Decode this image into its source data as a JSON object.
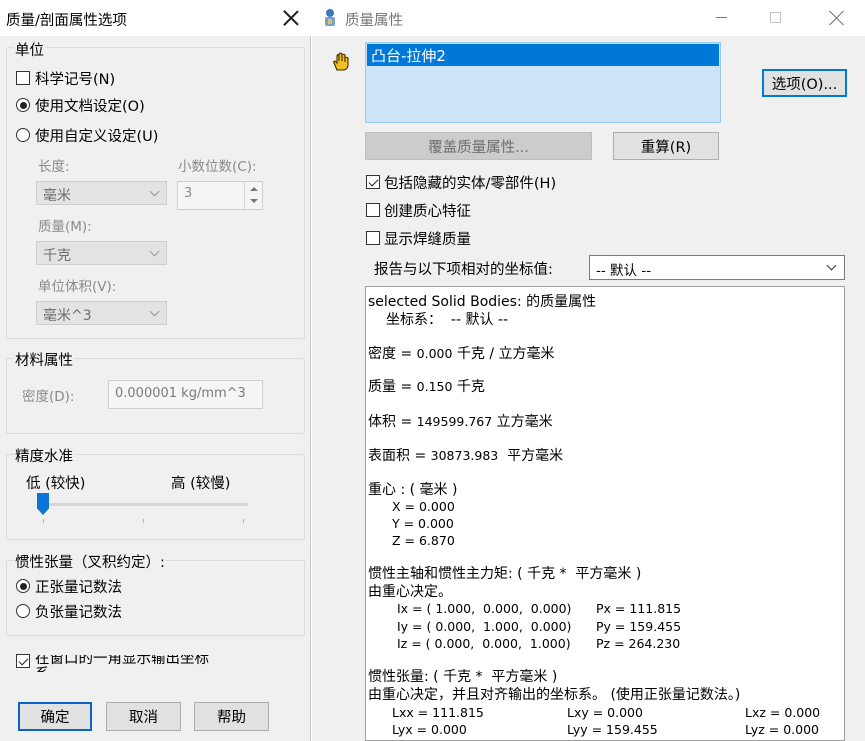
{
  "left": {
    "title": "质量/剖面属性选项",
    "units": {
      "heading": "单位",
      "scientific": "科学记号(N)",
      "use_doc": "使用文档设定(O)",
      "use_custom": "使用自定义设定(U)",
      "length_label": "长度:",
      "length_value": "毫米",
      "decimals_label": "小数位数(C):",
      "decimals_value": "3",
      "mass_label": "质量(M):",
      "mass_value": "千克",
      "volume_label": "单位体积(V):",
      "volume_value": "毫米^3"
    },
    "material": {
      "heading": "材料属性",
      "density_label": "密度(D):",
      "density_value": "0.000001 kg/mm^3"
    },
    "accuracy": {
      "heading": "精度水准",
      "low": "低 (较快)",
      "high": "高 (较慢)",
      "level": 0.0
    },
    "inertia": {
      "heading": "惯性张量（叉积约定）:",
      "positive": "正张量记数法",
      "negative": "负张量记数法"
    },
    "show_output_line1": "在窗口的一角显示输出坐标",
    "show_output_line2": "系",
    "ok": "确定",
    "cancel": "取消",
    "help": "帮助"
  },
  "right": {
    "title": "质量属性",
    "selected_body": "凸台-拉伸2",
    "options_btn": "选项(O)...",
    "override_btn": "覆盖质量属性...",
    "recalc_btn": "重算(R)",
    "include_hidden": "包括隐藏的实体/零部件(H)",
    "create_com": "创建质心特征",
    "show_weld": "显示焊缝质量",
    "report_label": "报告与以下项相对的坐标值:",
    "coord_value": "-- 默认 --",
    "results": {
      "header": "selected Solid Bodies: 的质量属性",
      "coord_sys": "坐标系：  -- 默认 --",
      "density": [
        "密度 = ",
        "0.000",
        " 千克 / 立方毫米"
      ],
      "mass": [
        "质量 = ",
        "0.150",
        " 千克"
      ],
      "volume": [
        "体积 = ",
        "149599.767",
        " 立方毫米"
      ],
      "area": [
        "表面积 = ",
        "30873.983",
        "  平方毫米"
      ],
      "com_heading": "重心 : ( 毫米 )",
      "com_x": "X = 0.000",
      "com_y": "Y = 0.000",
      "com_z": "Z = 6.870",
      "principal_heading": "惯性主轴和惯性主力矩: ( 千克 *  平方毫米 )",
      "principal_sub": "由重心决定。",
      "ix": "Ix = ( 1.000,  0.000,  0.000)",
      "iy": "Iy = ( 0.000,  1.000,  0.000)",
      "iz": "Iz = ( 0.000,  0.000,  1.000)",
      "px": "Px = 111.815",
      "py": "Py = 159.455",
      "pz": "Pz = 264.230",
      "tensor_heading": "惯性张量: ( 千克 *  平方毫米 )",
      "tensor_sub": "由重心决定，并且对齐输出的坐标系。 (使用正张量记数法。)",
      "lxx": "Lxx = 111.815",
      "lxy": "Lxy = 0.000",
      "lxz": "Lxz = 0.000",
      "lyx": "Lyx = 0.000",
      "lyy": "Lyy = 159.455",
      "lyz": "Lyz = 0.000"
    }
  },
  "icons": {
    "left_close": "close-icon",
    "right_app": "mass-properties-app-icon",
    "hand": "hand-pointer-icon"
  },
  "colors": {
    "selection": "#0078d7",
    "list_bg": "#cce4f7",
    "slider": "#0b74d8"
  }
}
